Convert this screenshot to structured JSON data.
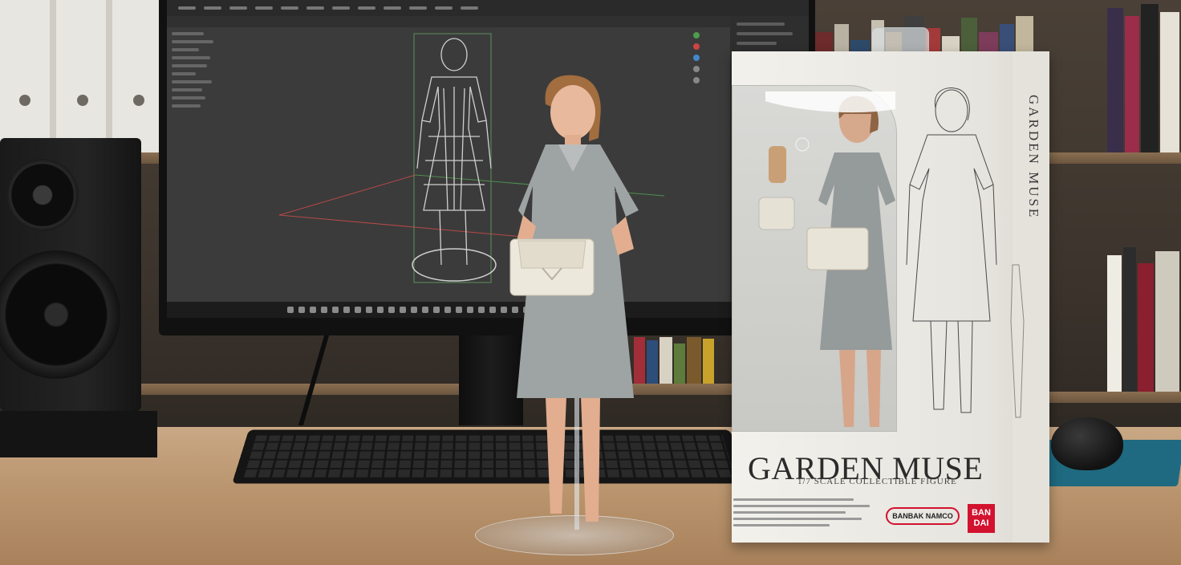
{
  "product_box": {
    "title": "GARDEN MUSE",
    "subtitle": "1/7 SCALE COLLECTIBLE FIGURE",
    "side_text": "GARDEN MUSE",
    "brand_pill": "BANBAK NAMCO",
    "brand_square_line1": "BAN",
    "brand_square_line2": "DAI"
  },
  "colors": {
    "brand_red": "#d2122e",
    "dress_gray": "#9ea3a3",
    "viewport_bg": "#3b3b3b",
    "desk_wood": "#b8936c"
  },
  "icons": {
    "speaker": "speaker-icon",
    "mouse": "mouse-icon"
  }
}
